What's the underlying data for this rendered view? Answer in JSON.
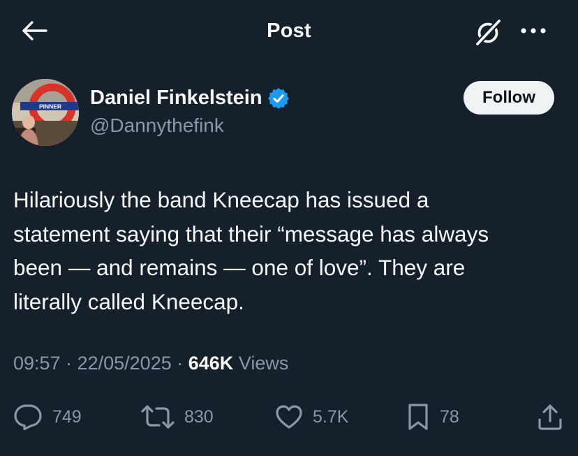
{
  "header": {
    "title": "Post",
    "back_icon": "arrow-left-icon",
    "grok_icon": "grok-icon",
    "more_icon": "more-horizontal-icon"
  },
  "author": {
    "name": "Daniel Finkelstein",
    "handle": "@Dannythefink",
    "verified": true,
    "verified_color": "#1d9bf0",
    "avatar_sign_text": "PINNER",
    "follow_label": "Follow"
  },
  "post": {
    "text_lines": [
      "Hilariously the band Kneecap has issued a",
      "statement saying that their “message has always",
      "been — and remains — one of love”. They are",
      "literally called Kneecap."
    ],
    "time": "09:57",
    "date": "22/05/2025",
    "separator": "·",
    "views_count": "646K",
    "views_label": "Views"
  },
  "actions": {
    "replies": "749",
    "reposts": "830",
    "likes": "5.7K",
    "bookmarks": "78"
  },
  "colors": {
    "background": "#15202b",
    "text": "#f7f9f9",
    "secondary": "#8b98a5",
    "follow_bg": "#eff3f4"
  }
}
